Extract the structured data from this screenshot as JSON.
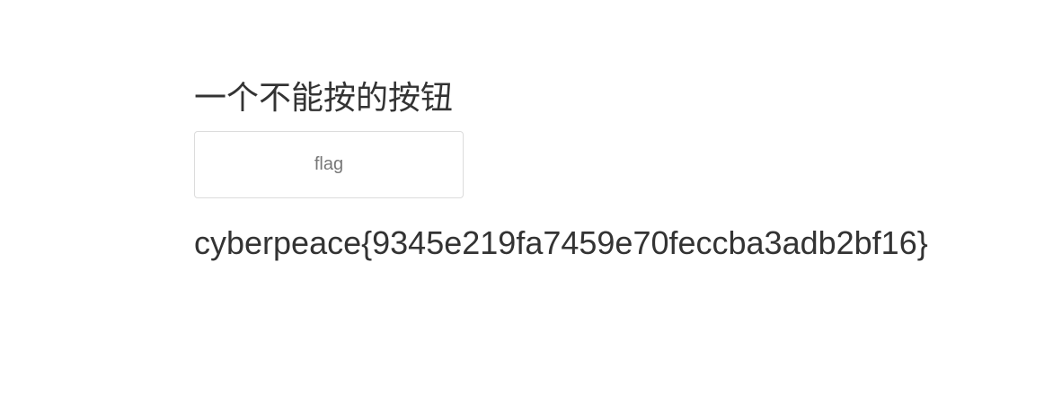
{
  "page": {
    "heading": "一个不能按的按钮",
    "button_label": "flag",
    "flag_text": "cyberpeace{9345e219fa7459e70feccba3adb2bf16}"
  },
  "colors": {
    "text": "#333333",
    "button_text": "#777777",
    "button_border": "#dcdcdc",
    "background": "#ffffff"
  }
}
